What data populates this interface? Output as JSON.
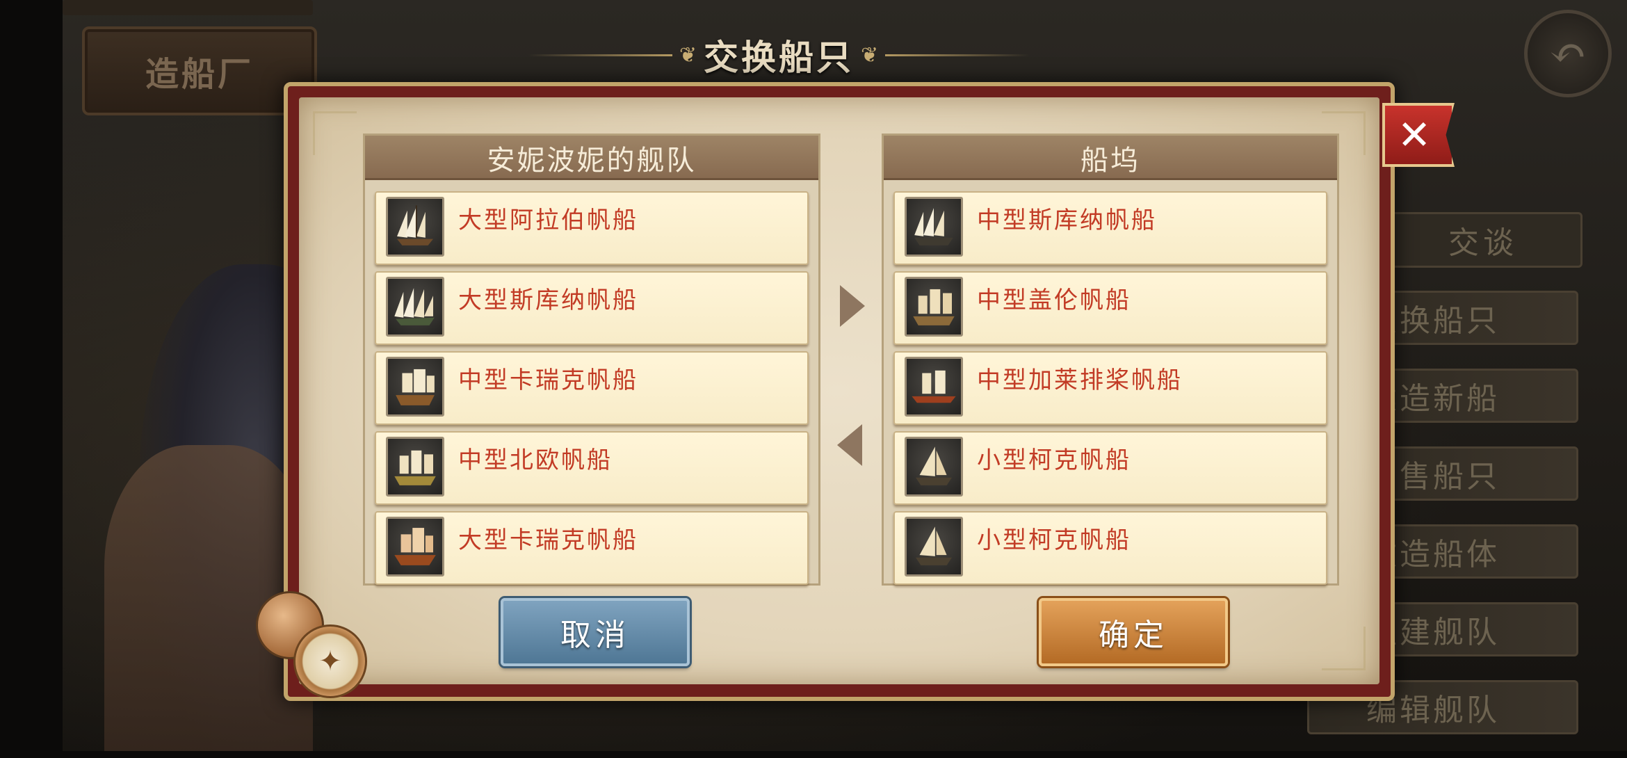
{
  "background": {
    "sign_text": "造船厂",
    "side_menu": [
      "交谈",
      "交换船只",
      "建造新船",
      "出售船只",
      "改造船体",
      "组建舰队",
      "编辑舰队"
    ]
  },
  "dialog": {
    "title": "交换船只",
    "close_glyph": "✕",
    "fleet_panel": {
      "header": "安妮波妮的舰队",
      "ships": [
        {
          "name": "大型阿拉伯帆船",
          "icon": "ship-icon"
        },
        {
          "name": "大型斯库纳帆船",
          "icon": "ship-icon"
        },
        {
          "name": "中型卡瑞克帆船",
          "icon": "ship-icon"
        },
        {
          "name": "中型北欧帆船",
          "icon": "ship-icon"
        },
        {
          "name": "大型卡瑞克帆船",
          "icon": "ship-icon"
        }
      ]
    },
    "dock_panel": {
      "header": "船坞",
      "ships": [
        {
          "name": "中型斯库纳帆船",
          "icon": "ship-icon"
        },
        {
          "name": "中型盖伦帆船",
          "icon": "ship-icon"
        },
        {
          "name": "中型加莱排桨帆船",
          "icon": "ship-icon"
        },
        {
          "name": "小型柯克帆船",
          "icon": "ship-icon"
        },
        {
          "name": "小型柯克帆船",
          "icon": "ship-icon"
        }
      ]
    },
    "cancel_label": "取消",
    "confirm_label": "确定"
  },
  "colors": {
    "ship_name": "#c23b25",
    "panel_header": "#86694f",
    "frame_red": "#6e1f1c",
    "cancel_blue": "#4f7795",
    "confirm_orange": "#b46b25"
  }
}
